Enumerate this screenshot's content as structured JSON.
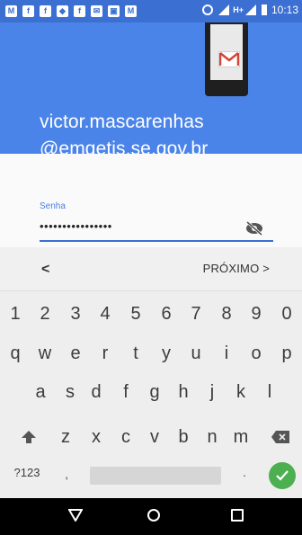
{
  "status_bar": {
    "time": "10:13",
    "network": "H+",
    "notification_icons": [
      "M",
      "f",
      "f",
      "fb-messenger",
      "f",
      "mail",
      "image",
      "gmail"
    ]
  },
  "header": {
    "email_line1": "victor.mascarenhas",
    "email_line2": "@emgetis.se.gov.br"
  },
  "form": {
    "label": "Senha",
    "value": "••••••••••••••••"
  },
  "nav": {
    "back": "<",
    "next": "PRÓXIMO >"
  },
  "keyboard": {
    "row_numbers": [
      "1",
      "2",
      "3",
      "4",
      "5",
      "6",
      "7",
      "8",
      "9",
      "0"
    ],
    "row_top": [
      "q",
      "w",
      "e",
      "r",
      "t",
      "y",
      "u",
      "i",
      "o",
      "p"
    ],
    "row_mid": [
      "a",
      "s",
      "d",
      "f",
      "g",
      "h",
      "j",
      "k",
      "l"
    ],
    "row_bottom": [
      "z",
      "x",
      "c",
      "v",
      "b",
      "n",
      "m"
    ],
    "symbols": "?123",
    "comma": ",",
    "period": "."
  },
  "colors": {
    "header_blue": "#4b84e8",
    "status_blue": "#3b6fd2",
    "accent": "#3b6fd2",
    "enter_green": "#4caf50"
  }
}
